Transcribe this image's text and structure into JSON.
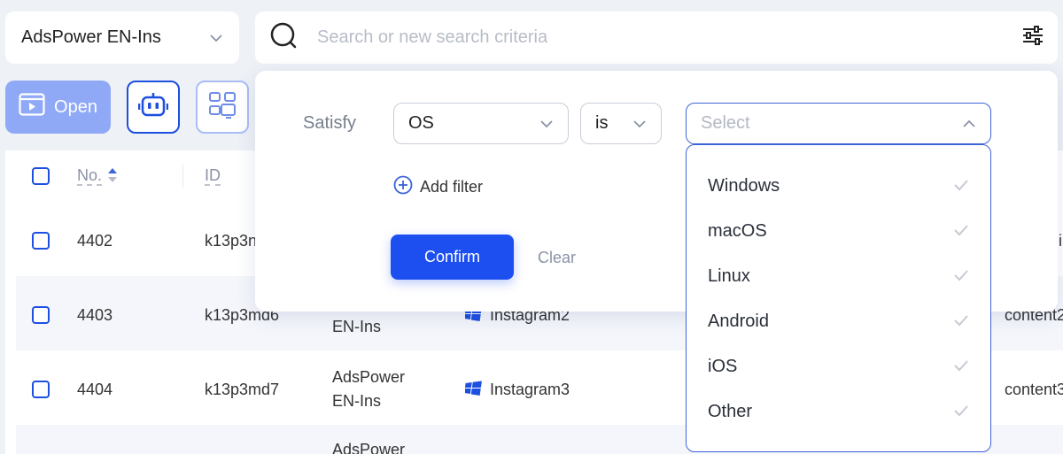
{
  "group_selector": {
    "value": "AdsPower EN-Ins",
    "icon": "chevron-down-icon"
  },
  "search": {
    "placeholder": "Search or new search criteria"
  },
  "toolbar": {
    "open_label": "Open"
  },
  "table": {
    "headers": {
      "no": "No.",
      "id": "ID"
    },
    "rows": [
      {
        "no": "4402",
        "id": "k13p3n",
        "group_line1": "",
        "group_line2": "",
        "name": "",
        "remark": "i"
      },
      {
        "no": "4403",
        "id": "k13p3md6",
        "group_line1": "",
        "group_line2": "EN-Ins",
        "name": "Instagram2",
        "remark": "content2"
      },
      {
        "no": "4404",
        "id": "k13p3md7",
        "group_line1": "AdsPower",
        "group_line2": "EN-Ins",
        "name": "Instagram3",
        "remark": "content3"
      },
      {
        "no": "",
        "id": "",
        "group_line1": "AdsPower",
        "group_line2": "",
        "name": "",
        "remark": ""
      }
    ]
  },
  "filter": {
    "satisfy_label": "Satisfy",
    "field_value": "OS",
    "operator_value": "is",
    "value_placeholder": "Select",
    "add_filter_label": "Add filter",
    "confirm_label": "Confirm",
    "clear_label": "Clear",
    "options": [
      "Windows",
      "macOS",
      "Linux",
      "Android",
      "iOS",
      "Other"
    ]
  },
  "colors": {
    "accent": "#1d4ff0",
    "open_button": "#8fa9f6",
    "dropdown_border": "#3d63d8"
  }
}
